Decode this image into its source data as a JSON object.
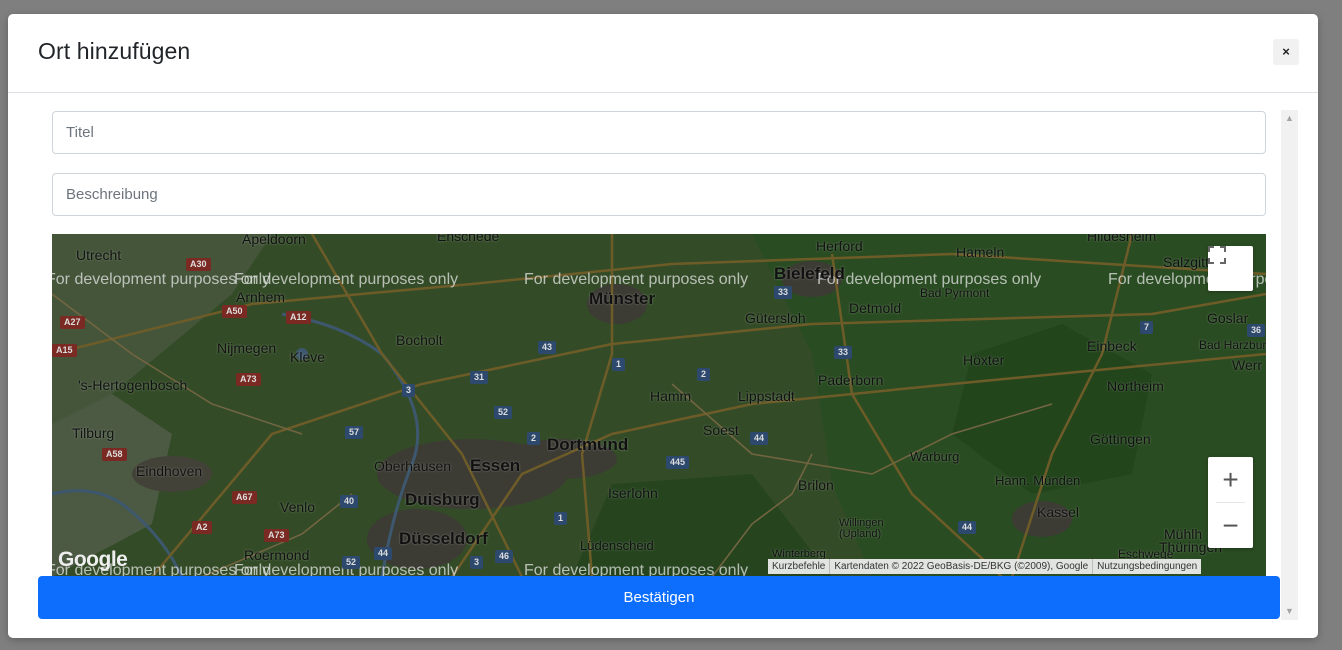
{
  "modal": {
    "title": "Ort hinzufügen",
    "close_label": "×"
  },
  "form": {
    "title_placeholder": "Titel",
    "description_placeholder": "Beschreibung",
    "confirm_label": "Bestätigen"
  },
  "map": {
    "watermark": "For development purposes only",
    "cities": [
      "Utrecht",
      "Apeldoorn",
      "Enschede",
      "Herford",
      "Hameln",
      "Hildesheim",
      "Bielefeld",
      "Bad Pyrmont",
      "Münster",
      "Detmold",
      "Arnhem",
      "Gütersloh",
      "Goslar",
      "Salzgitt",
      "Bocholt",
      "Nijmegen",
      "Kleve",
      "Einbeck",
      "Bad Harzburg",
      "Höxter",
      "'s-Hertogenbosch",
      "Paderborn",
      "Northeim",
      "Werr",
      "Hamm",
      "Lippstadt",
      "Tilburg",
      "Soest",
      "Göttingen",
      "Dortmund",
      "Oberhausen",
      "Essen",
      "Warburg",
      "Eindhoven",
      "Hann. Münden",
      "Duisburg",
      "Iserlohn",
      "Brilon",
      "Venlo",
      "Kassel",
      "Düsseldorf",
      "Willingen (Upland)",
      "Roermond",
      "Lüdenscheid",
      "Winterberg",
      "Eschwege",
      "Mühlh",
      "Thüringen"
    ],
    "roads": [
      "A30",
      "A50",
      "A12",
      "A27",
      "A15",
      "A73",
      "A58",
      "A67",
      "A2",
      "A73",
      "3",
      "31",
      "43",
      "1",
      "2",
      "33",
      "33",
      "7",
      "36",
      "52",
      "57",
      "2",
      "44",
      "445",
      "40",
      "1",
      "44",
      "46",
      "3",
      "44",
      "52"
    ],
    "google_label": "Google",
    "attribution": {
      "shortcuts": "Kurzbefehle",
      "data": "Kartendaten © 2022 GeoBasis-DE/BKG (©2009), Google",
      "terms": "Nutzungsbedingungen"
    },
    "zoom_in": "+",
    "zoom_out": "−",
    "colors": {
      "land": "#4e7a3f",
      "forest": "#3d8a3a",
      "urban": "#6c6a5c",
      "road": "#c9a84a"
    }
  },
  "scrollbar": {
    "up": "▲",
    "down": "▼"
  }
}
